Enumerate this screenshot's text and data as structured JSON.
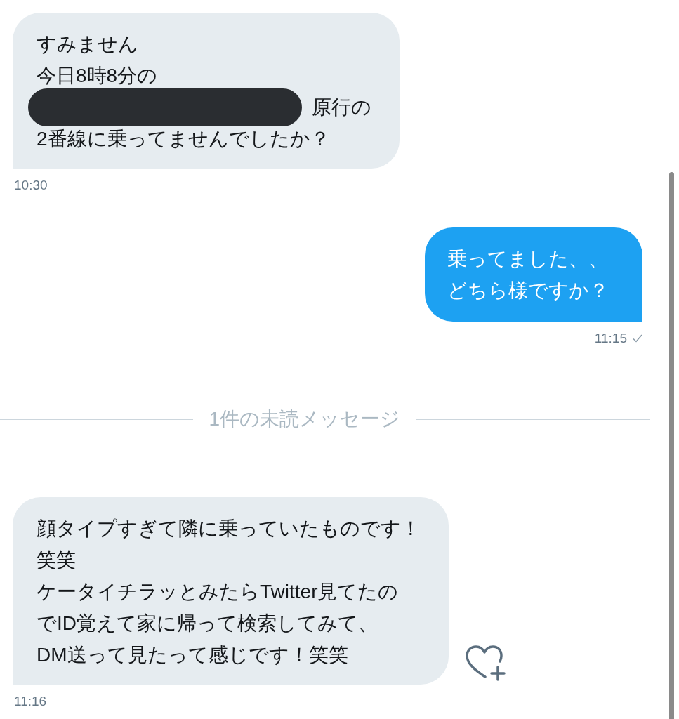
{
  "messages": [
    {
      "kind": "received",
      "lines": [
        {
          "text": "すみません",
          "redacted_before": false
        },
        {
          "text": "今日8時8分の",
          "redacted_before": false
        },
        {
          "text": "原行の",
          "redacted_before": true
        },
        {
          "text": "2番線に乗ってませんでしたか？",
          "redacted_before": false
        }
      ],
      "time": "10:30"
    },
    {
      "kind": "sent",
      "lines": [
        {
          "text": "乗ってました、、",
          "redacted_before": false
        },
        {
          "text": "どちら様ですか？",
          "redacted_before": false
        }
      ],
      "time": "11:15",
      "read": true
    },
    {
      "kind": "divider",
      "text": "1件の未読メッセージ"
    },
    {
      "kind": "received",
      "lines": [
        {
          "text": "顔タイプすぎて隣に乗っていたものです！",
          "redacted_before": false
        },
        {
          "text": "笑笑",
          "redacted_before": false
        },
        {
          "text": "ケータイチラッとみたらTwitter見てたの",
          "redacted_before": false
        },
        {
          "text": "でID覚えて家に帰って検索してみて、",
          "redacted_before": false
        },
        {
          "text": "DM送って見たって感じです！笑笑",
          "redacted_before": false
        }
      ],
      "time": "11:16",
      "like_button": true
    }
  ]
}
